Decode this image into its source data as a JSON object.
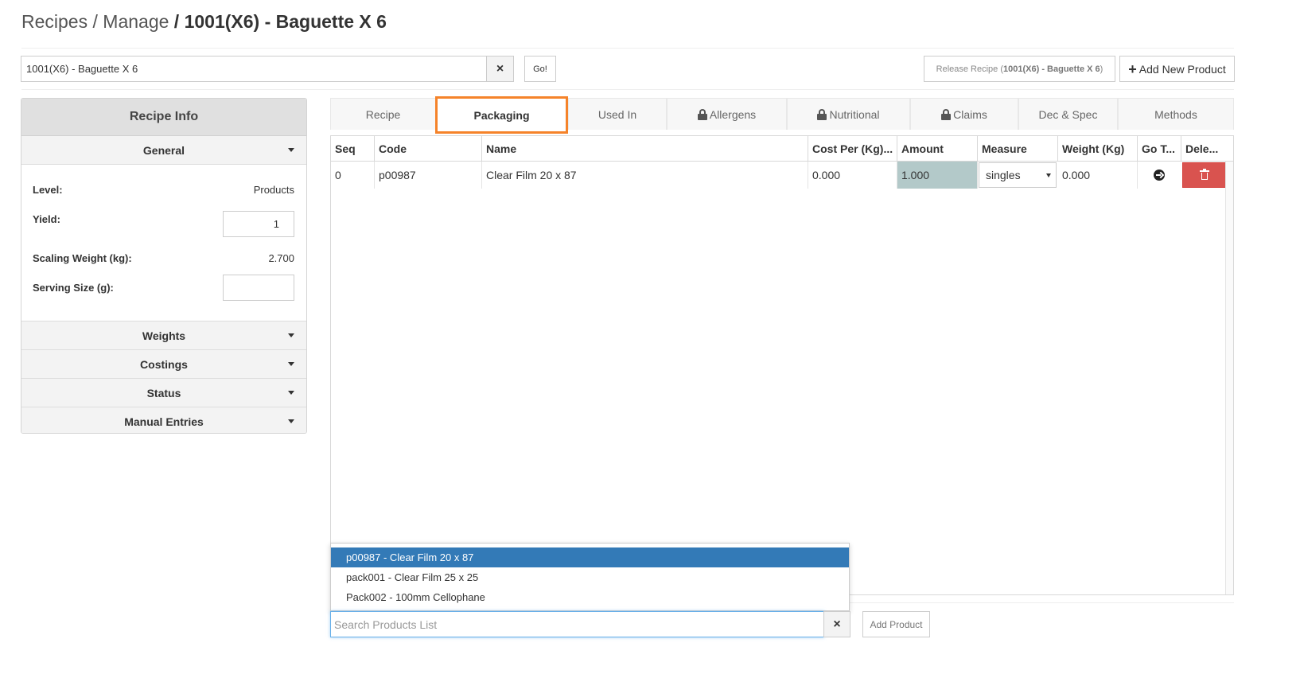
{
  "breadcrumb": {
    "part1": "Recipes",
    "sep1": " / ",
    "part2": "Manage",
    "sep2": " / ",
    "current": "1001(X6) - Baguette X 6"
  },
  "recipe_search": {
    "value": "1001(X6) - Baguette X 6",
    "clear_label": "×",
    "go_label": "Go!"
  },
  "actions": {
    "release_prefix": "Release Recipe (",
    "release_name": "1001(X6) - Baguette X 6",
    "release_suffix": ")",
    "add_new_plus": "+",
    "add_new_label": "Add New Product"
  },
  "recipe_info": {
    "title": "Recipe Info",
    "general_label": "General",
    "level_label": "Level:",
    "level_value": "Products",
    "yield_label": "Yield:",
    "yield_value": "1",
    "scaling_label": "Scaling Weight (kg):",
    "scaling_value": "2.700",
    "serving_label": "Serving Size (g):",
    "serving_value": "",
    "sections": [
      "Weights",
      "Costings",
      "Status",
      "Manual Entries"
    ]
  },
  "tabs": [
    {
      "label": "Recipe",
      "locked": false,
      "active": false
    },
    {
      "label": "Packaging",
      "locked": false,
      "active": true
    },
    {
      "label": "Used In",
      "locked": false,
      "active": false
    },
    {
      "label": "Allergens",
      "locked": true,
      "active": false
    },
    {
      "label": "Nutritional",
      "locked": true,
      "active": false
    },
    {
      "label": "Claims",
      "locked": true,
      "active": false
    },
    {
      "label": "Dec & Spec",
      "locked": false,
      "active": false
    },
    {
      "label": "Methods",
      "locked": false,
      "active": false
    }
  ],
  "grid": {
    "columns": [
      "Seq",
      "Code",
      "Name",
      "Cost Per (Kg)...",
      "Amount",
      "Measure",
      "Weight (Kg)",
      "Go T...",
      "Dele..."
    ],
    "rows": [
      {
        "seq": "0",
        "code": "p00987",
        "name": "Clear Film 20 x 87",
        "cost": "0.000",
        "amount": "1.000",
        "measure": "singles",
        "weight": "0.000"
      }
    ]
  },
  "dropdown": {
    "items": [
      {
        "label": "p00987 - Clear Film 20 x 87",
        "selected": true
      },
      {
        "label": "pack001 - Clear Film 25 x 25",
        "selected": false
      },
      {
        "label": "Pack002 - 100mm Cellophane",
        "selected": false
      }
    ]
  },
  "product_search": {
    "placeholder": "Search Products List",
    "clear_label": "×",
    "add_label": "Add Product"
  },
  "colors": {
    "active_tab_border": "#f5832a",
    "selected_item": "#337ab7",
    "delete_button": "#d9534f",
    "amount_cell": "#b3c9c9"
  }
}
